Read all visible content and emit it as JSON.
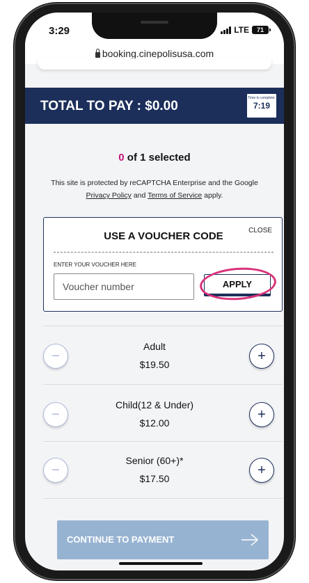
{
  "status_bar": {
    "time": "3:29",
    "network": "LTE",
    "battery": "71"
  },
  "browser": {
    "url": "booking.cinepolisusa.com"
  },
  "total": {
    "label": "TOTAL TO PAY : $0.00",
    "timer_caption": "Time to complete:",
    "timer_value": "7:19"
  },
  "selection": {
    "count": "0",
    "suffix": " of 1 selected"
  },
  "captcha": {
    "line1": "This site is protected by reCAPTCHA Enterprise and the Google",
    "privacy_link": "Privacy Policy",
    "and": " and ",
    "terms_link": "Terms of Service",
    "apply": " apply."
  },
  "voucher": {
    "title": "USE A VOUCHER CODE",
    "close_label": "CLOSE",
    "field_label": "ENTER YOUR VOUCHER HERE",
    "input_placeholder": "Voucher number",
    "input_value": "",
    "apply_label": "APPLY"
  },
  "tickets": [
    {
      "name": "Adult",
      "price": "$19.50",
      "minus": "−",
      "plus": "+"
    },
    {
      "name": "Child(12 & Under)",
      "price": "$12.00",
      "minus": "−",
      "plus": "+"
    },
    {
      "name": "Senior (60+)*",
      "price": "$17.50",
      "minus": "−",
      "plus": "+"
    }
  ],
  "continue_button": {
    "label": "CONTINUE TO PAYMENT",
    "icon": "arrow-right-icon"
  },
  "colors": {
    "navy": "#1c2f5b",
    "accent_pink": "#c2187a",
    "highlight_ring": "#d8327a",
    "continue_disabled": "#97b3d2"
  }
}
